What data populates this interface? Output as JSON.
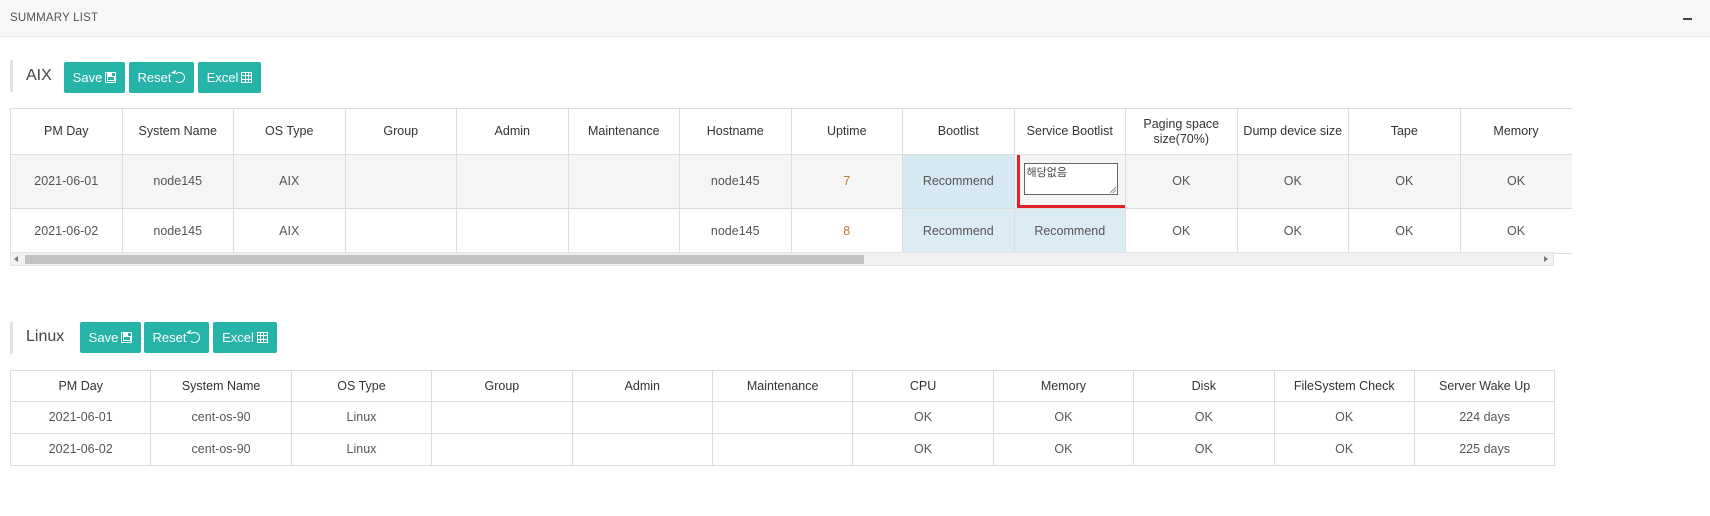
{
  "panel": {
    "title": "SUMMARY LIST",
    "collapse_icon": "minus-icon"
  },
  "aix": {
    "title": "AIX",
    "buttons": {
      "save": "Save",
      "reset": "Reset",
      "excel": "Excel"
    },
    "columns": [
      "PM Day",
      "System Name",
      "OS Type",
      "Group",
      "Admin",
      "Maintenance",
      "Hostname",
      "Uptime",
      "Bootlist",
      "Service Bootlist",
      "Paging space size(70%)",
      "Dump device size",
      "Tape",
      "Memory"
    ],
    "rows": [
      [
        "2021-06-01",
        "node145",
        "AIX",
        "",
        "",
        "",
        "node145",
        "7",
        "Recommend",
        "해당없음",
        "OK",
        "OK",
        "OK",
        "OK"
      ],
      [
        "2021-06-02",
        "node145",
        "AIX",
        "",
        "",
        "",
        "node145",
        "8",
        "Recommend",
        "Recommend",
        "OK",
        "OK",
        "OK",
        "OK"
      ]
    ],
    "editing_value": "해당없음",
    "scroll_position": 0.0
  },
  "linux": {
    "title": "Linux",
    "buttons": {
      "save": "Save",
      "reset": "Reset",
      "excel": "Excel"
    },
    "columns": [
      "PM Day",
      "System Name",
      "OS Type",
      "Group",
      "Admin",
      "Maintenance",
      "CPU",
      "Memory",
      "Disk",
      "FileSystem Check",
      "Server Wake Up"
    ],
    "rows": [
      [
        "2021-06-01",
        "cent-os-90",
        "Linux",
        "",
        "",
        "",
        "OK",
        "OK",
        "OK",
        "OK",
        "224 days"
      ],
      [
        "2021-06-02",
        "cent-os-90",
        "Linux",
        "",
        "",
        "",
        "OK",
        "OK",
        "OK",
        "OK",
        "225 days"
      ]
    ]
  },
  "colors": {
    "accent": "#26b3a8",
    "highlight": "#dbecf5",
    "focus_border": "#e0222a"
  }
}
